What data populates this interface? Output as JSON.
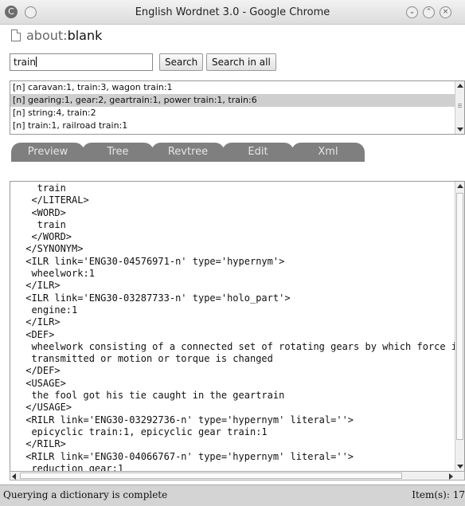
{
  "window": {
    "title": "English Wordnet 3.0 - Google Chrome",
    "app_icon": "C",
    "controls": {
      "minimize_glyph": "⌄",
      "maximize_glyph": "⌃",
      "close_glyph": "×"
    }
  },
  "address": {
    "prefix": "about:",
    "page": "blank"
  },
  "search": {
    "value": "train",
    "search_label": "Search",
    "search_all_label": "Search in all"
  },
  "results": [
    "[n] caravan:1, train:3, wagon train:1",
    "[n] gearing:1, gear:2, geartrain:1, power train:1, train:6",
    "[n] string:4, train:2",
    "[n] train:1, railroad train:1"
  ],
  "tabs": [
    "Preview",
    "Tree",
    "Revtree",
    "Edit",
    "Xml"
  ],
  "xml_lines": [
    "   train",
    "  </LITERAL>",
    "  <WORD>",
    "   train",
    "  </WORD>",
    " </SYNONYM>",
    " <ILR link='ENG30-04576971-n' type='hypernym'>",
    "  wheelwork:1",
    " </ILR>",
    " <ILR link='ENG30-03287733-n' type='holo_part'>",
    "  engine:1",
    " </ILR>",
    " <DEF>",
    "  wheelwork consisting of a connected set of rotating gears by which force is",
    "  transmitted or motion or torque is changed",
    " </DEF>",
    " <USAGE>",
    "  the fool got his tie caught in the geartrain",
    " </USAGE>",
    " <RILR link='ENG30-03292736-n' type='hypernym' literal=''>",
    "  epicyclic train:1, epicyclic gear train:1",
    " </RILR>",
    " <RILR link='ENG30-04066767-n' type='hypernym' literal=''>",
    "  reduction gear:1"
  ],
  "status": {
    "message": "Querying a dictionary is complete",
    "count": "Item(s): 17"
  }
}
